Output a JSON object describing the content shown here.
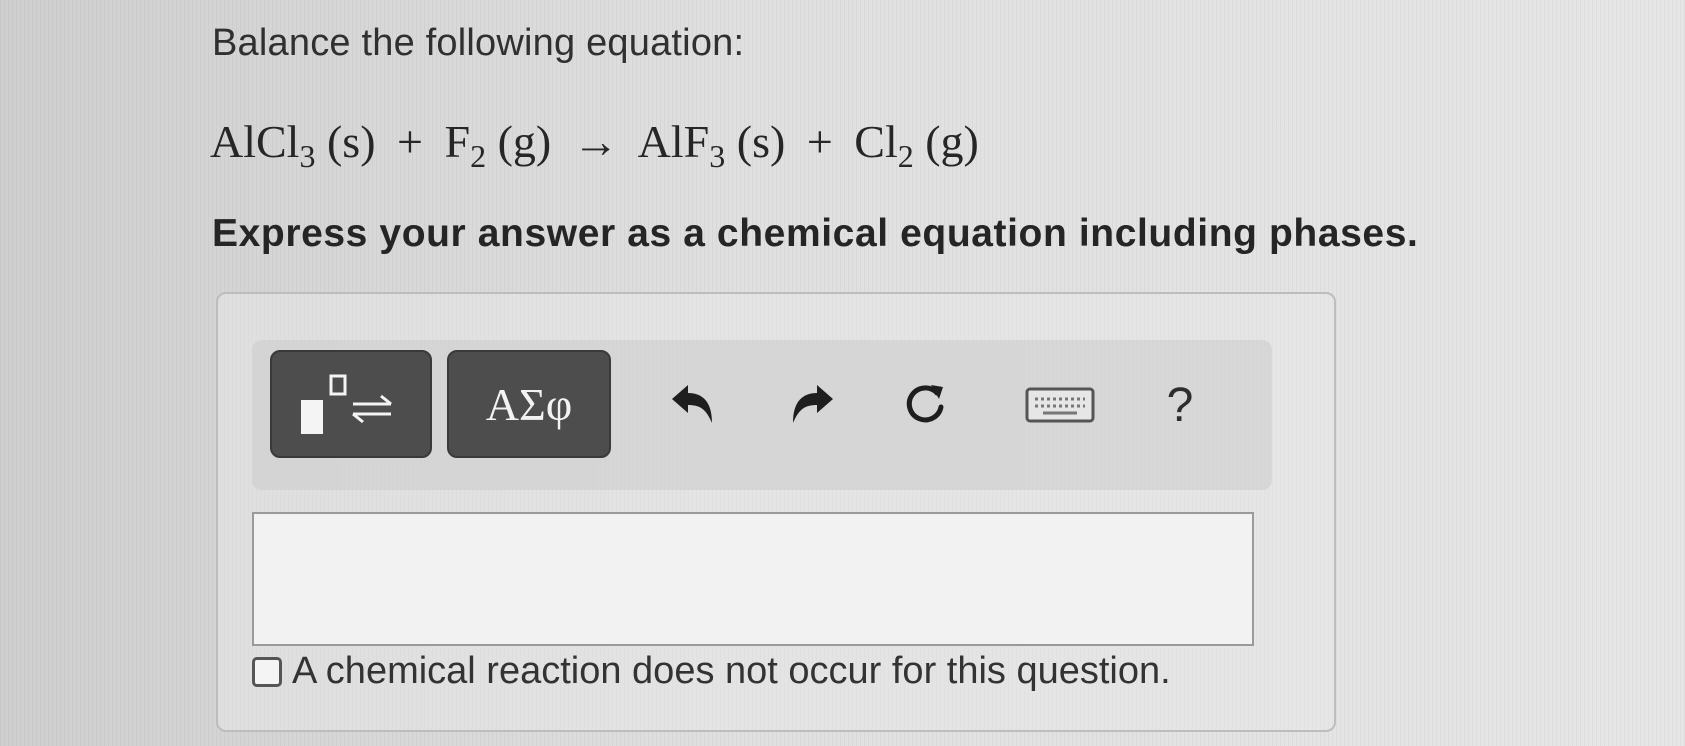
{
  "question": {
    "label": "Balance the following equation:",
    "equation": {
      "r1": "AlCl",
      "r1_sub": "3",
      "r1_phase": "(s)",
      "plus1": "+",
      "r2": "F",
      "r2_sub": "2",
      "r2_phase": "(g)",
      "arrow": "→",
      "p1": "AlF",
      "p1_sub": "3",
      "p1_phase": "(s)",
      "plus2": "+",
      "p2": "Cl",
      "p2_sub": "2",
      "p2_phase": "(g)"
    },
    "instruction": "Express your answer as a chemical equation including phases."
  },
  "toolbar": {
    "templates_icon": "templates-reaction-arrow-icon",
    "greek_label": "ΑΣφ",
    "undo_icon": "undo-icon",
    "redo_icon": "redo-icon",
    "reset_icon": "reset-icon",
    "keyboard_icon": "keyboard-icon",
    "help_label": "?"
  },
  "answer": {
    "value": "",
    "no_reaction_checked": false,
    "no_reaction_label": "A chemical reaction does not occur for this question."
  }
}
